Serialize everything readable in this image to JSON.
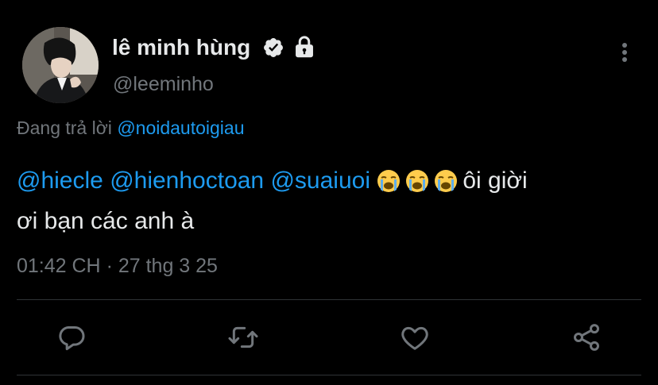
{
  "author": {
    "display_name": "lê minh hùng",
    "handle": "@leeminho",
    "avatar_icon": "profile-photo",
    "verified": true,
    "protected": true
  },
  "reply": {
    "prefix": "Đang trả lời ",
    "to_handle": "@noidautoigiau"
  },
  "tweet": {
    "mention_1": "@hiecle",
    "mention_2": "@hienhoctoan",
    "mention_3": "@suaiuoi",
    "emoji": "loudly-crying-face",
    "text_line_1": "ôi giời",
    "text_line_2": "ơi bạn các anh à"
  },
  "meta": {
    "time": "01:42 CH",
    "separator": " · ",
    "date": "27 thg 3 25"
  },
  "actions": {
    "reply_icon": "reply-icon",
    "retweet_icon": "retweet-icon",
    "like_icon": "heart-icon",
    "share_icon": "share-icon"
  },
  "colors": {
    "background": "#000000",
    "text_primary": "#e7e9ea",
    "text_secondary": "#71767b",
    "link": "#1d9bf0",
    "divider": "#2f3336"
  }
}
